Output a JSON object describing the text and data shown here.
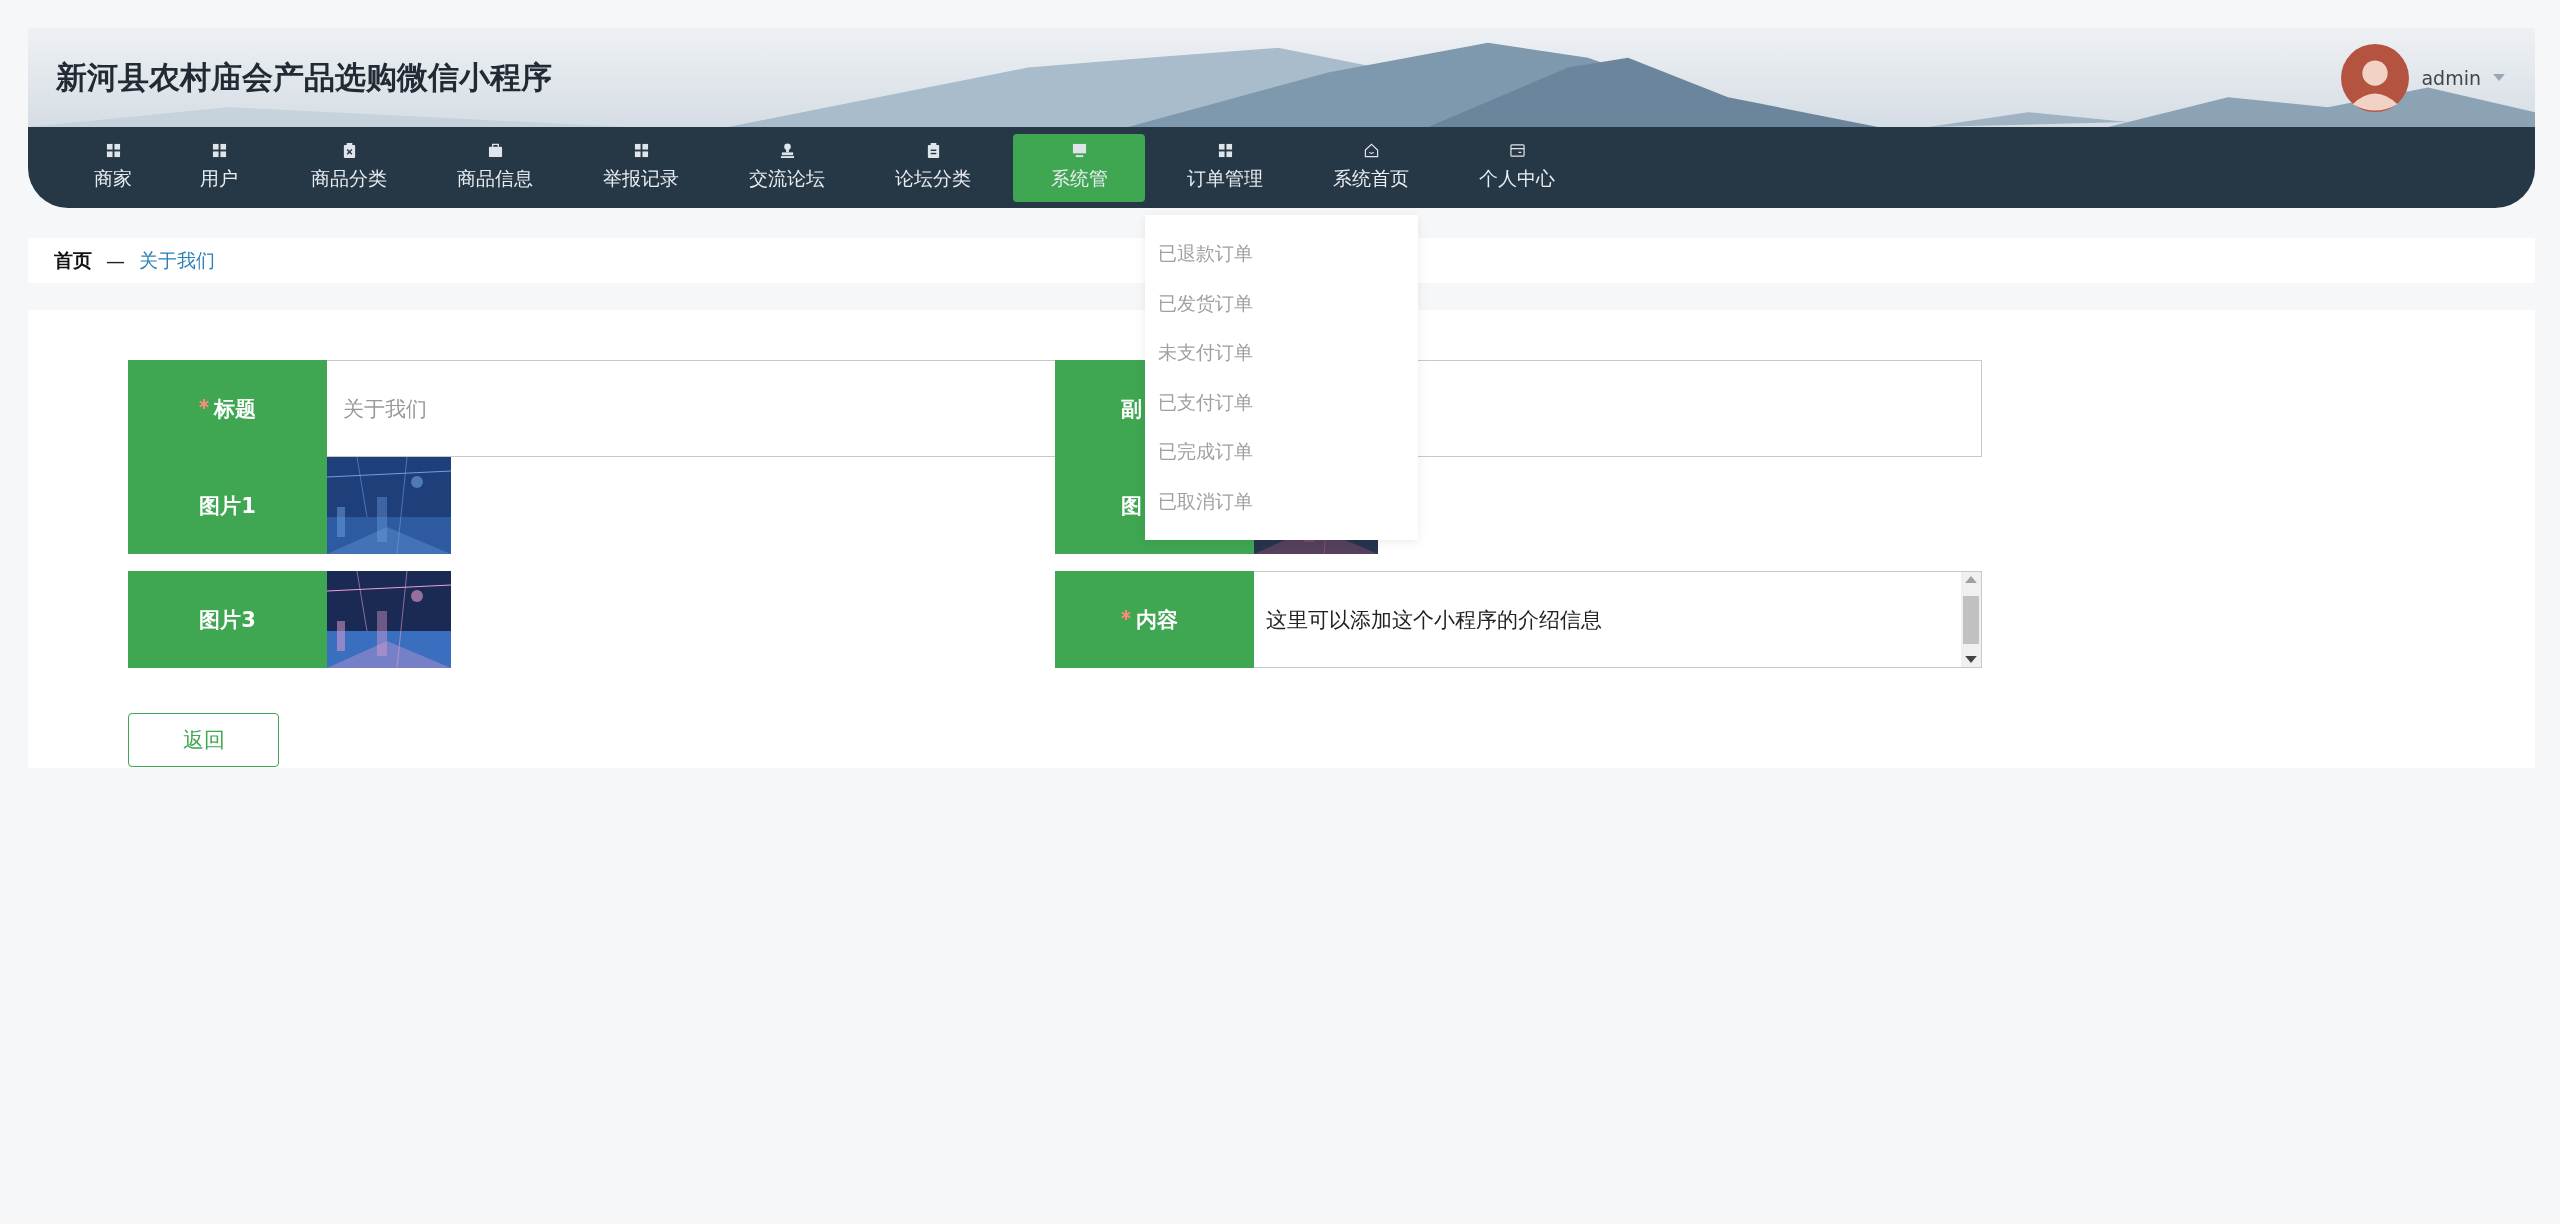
{
  "header": {
    "title": "新河县农村庙会产品选购微信小程序",
    "user": "admin"
  },
  "nav": [
    {
      "label": "商家",
      "selected": false
    },
    {
      "label": "用户",
      "selected": false
    },
    {
      "label": "商品分类",
      "selected": false
    },
    {
      "label": "商品信息",
      "selected": false
    },
    {
      "label": "举报记录",
      "selected": false
    },
    {
      "label": "交流论坛",
      "selected": false
    },
    {
      "label": "论坛分类",
      "selected": false
    },
    {
      "label": "系统管",
      "selected": true
    },
    {
      "label": "订单管理",
      "selected": false
    },
    {
      "label": "系统首页",
      "selected": false
    },
    {
      "label": "个人中心",
      "selected": false
    }
  ],
  "dropdown": [
    "已退款订单",
    "已发货订单",
    "未支付订单",
    "已支付订单",
    "已完成订单",
    "已取消订单"
  ],
  "breadcrumb": {
    "home": "首页",
    "separator": "—",
    "current": "关于我们"
  },
  "form": {
    "fields": [
      {
        "label": "标题",
        "required": true,
        "kind": "text",
        "value": "关于我们"
      },
      {
        "label": "副",
        "required": false,
        "kind": "text"
      },
      {
        "label": "图片1",
        "required": false,
        "kind": "picture"
      },
      {
        "label": "图",
        "required": false,
        "kind": "picture"
      },
      {
        "label": "图片3",
        "required": false,
        "kind": "picture"
      },
      {
        "label": "内容",
        "required": true,
        "kind": "textarea",
        "value": "这里可以添加这个小程序的介绍信息"
      }
    ],
    "back_button": "返回"
  }
}
